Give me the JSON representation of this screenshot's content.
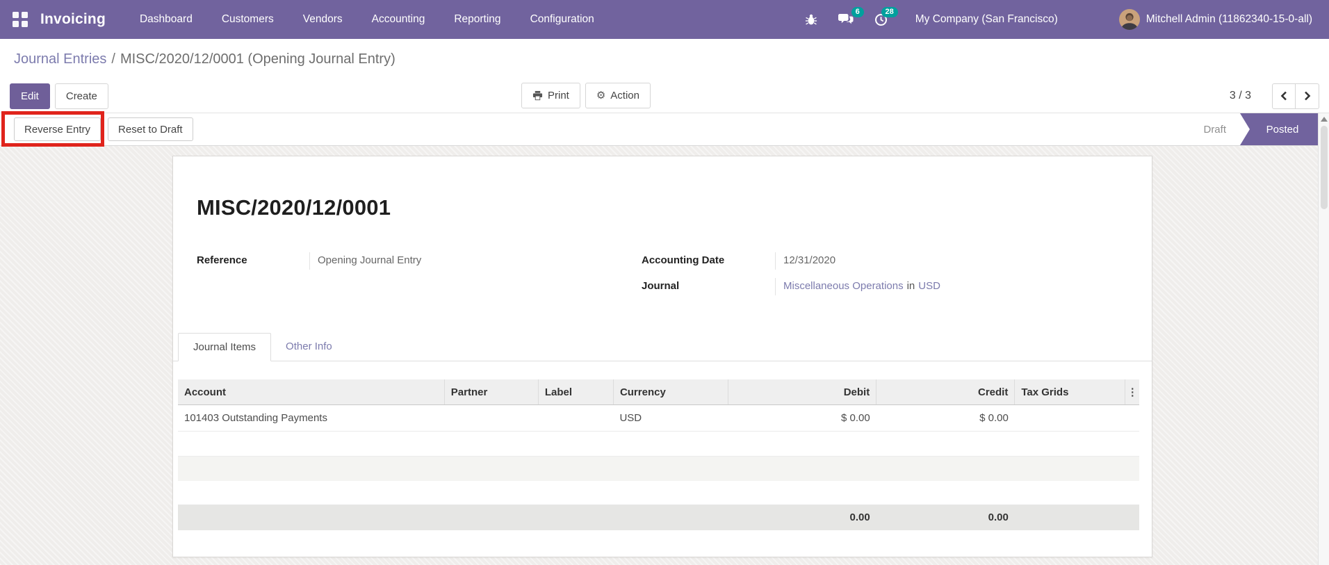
{
  "navbar": {
    "app_name": "Invoicing",
    "menu_items": [
      "Dashboard",
      "Customers",
      "Vendors",
      "Accounting",
      "Reporting",
      "Configuration"
    ],
    "messages_badge": "6",
    "activities_badge": "28",
    "company_name": "My Company (San Francisco)",
    "user_name": "Mitchell Admin (11862340-15-0-all)"
  },
  "breadcrumb": {
    "parent": "Journal Entries",
    "separator": "/",
    "current": "MISC/2020/12/0001 (Opening Journal Entry)"
  },
  "control_panel": {
    "edit_label": "Edit",
    "create_label": "Create",
    "print_label": "Print",
    "action_label": "Action",
    "pager_value": "3 / 3"
  },
  "statusbar": {
    "reverse_entry_label": "Reverse Entry",
    "reset_to_draft_label": "Reset to Draft",
    "state_draft": "Draft",
    "state_posted": "Posted"
  },
  "sheet": {
    "title": "MISC/2020/12/0001",
    "fields": {
      "reference_label": "Reference",
      "reference_value": "Opening Journal Entry",
      "accounting_date_label": "Accounting Date",
      "accounting_date_value": "12/31/2020",
      "journal_label": "Journal",
      "journal_value": "Miscellaneous Operations",
      "journal_connector": "in",
      "journal_currency": "USD"
    },
    "tabs": {
      "journal_items": "Journal Items",
      "other_info": "Other Info"
    },
    "table": {
      "columns": [
        "Account",
        "Partner",
        "Label",
        "Currency",
        "Debit",
        "Credit",
        "Tax Grids"
      ],
      "options_icon": "⋮",
      "rows": [
        {
          "account": "101403 Outstanding Payments",
          "partner": "",
          "label": "",
          "currency": "USD",
          "debit": "$ 0.00",
          "credit": "$ 0.00",
          "tax_grids": ""
        }
      ],
      "totals": {
        "debit": "0.00",
        "credit": "0.00"
      }
    }
  },
  "colors": {
    "navbar_bg": "#71639e",
    "badge_bg": "#00a09d",
    "primary_button": "#6f5f99",
    "link": "#7c7bad",
    "posted_state_bg": "#71639e",
    "annotation": "#e0241c"
  }
}
